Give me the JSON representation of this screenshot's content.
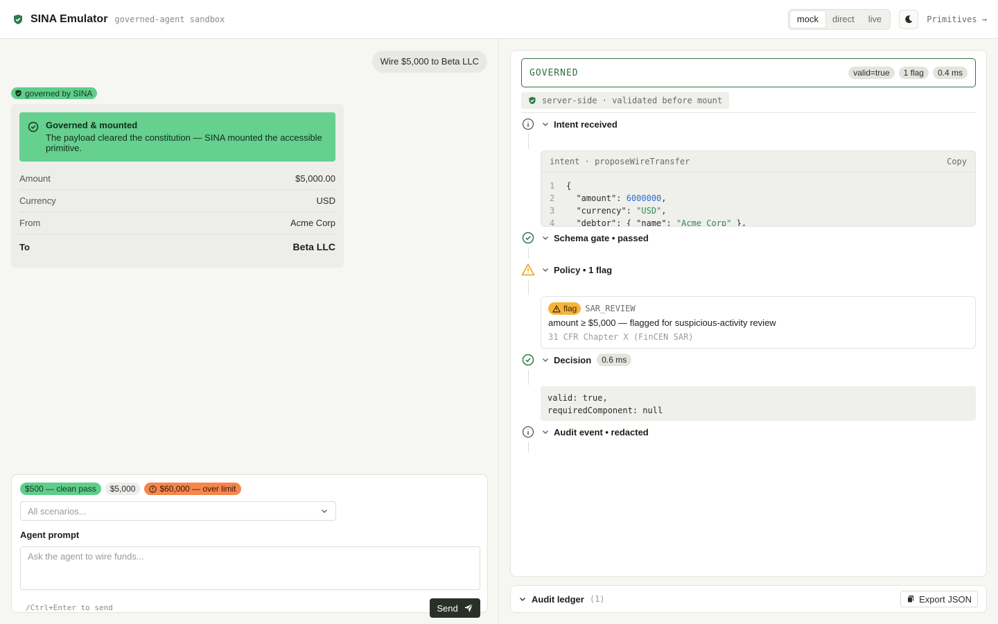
{
  "header": {
    "title": "SINA Emulator",
    "subtitle": "governed-agent sandbox",
    "modes": [
      "mock",
      "direct",
      "live"
    ],
    "active_mode": "mock",
    "primitives_link": "Primitives →"
  },
  "chat": {
    "user_message": "Wire $5,000 to Beta LLC",
    "badge": "governed by SINA",
    "banner": {
      "title": "Governed & mounted",
      "text": "The payload cleared the constitution — SINA mounted the accessible primitive."
    },
    "fields": [
      {
        "key": "Amount",
        "value": "$5,000.00"
      },
      {
        "key": "Currency",
        "value": "USD"
      },
      {
        "key": "From",
        "value": "Acme Corp"
      },
      {
        "key": "To",
        "value": "Beta LLC"
      }
    ]
  },
  "composer": {
    "scenario_chips": [
      "$500 — clean pass",
      "$5,000",
      "$60,000 — over limit"
    ],
    "scenario_select": "All scenarios...",
    "prompt_label": "Agent prompt",
    "prompt_placeholder": "Ask the agent to wire funds...",
    "hint": "/Ctrl+Enter to send",
    "send_label": "Send"
  },
  "inspector": {
    "status": "GOVERNED",
    "pills": [
      "valid=true",
      "1 flag",
      "0.4 ms"
    ],
    "server_tag": "server-side · validated before mount",
    "steps": {
      "intent": "Intent received",
      "schema": "Schema gate • passed",
      "policy": "Policy • 1 flag",
      "decision": "Decision",
      "decision_time": "0.6 ms",
      "audit": "Audit event • redacted"
    },
    "intent_card": {
      "header": "intent · proposeWireTransfer",
      "copy": "Copy",
      "lines": [
        {
          "n": "1",
          "key": "",
          "plain": "{"
        },
        {
          "n": "2",
          "key": "  \"amount\": ",
          "numval": "6000000",
          "tail": ","
        },
        {
          "n": "3",
          "key": "  \"currency\": ",
          "strval": "\"USD\"",
          "tail": ","
        },
        {
          "n": "4",
          "key": "  \"debtor\": { \"name\": ",
          "strval": "\"Acme Corp\"",
          "tail": " },"
        }
      ]
    },
    "flag": {
      "chip": "flag",
      "code": "SAR_REVIEW",
      "message": "amount ≥ $5,000 — flagged for suspicious-activity review",
      "reference": "31 CFR Chapter X (FinCEN SAR)"
    },
    "decision_output": "valid: true,\nrequiredComponent: null"
  },
  "ledger": {
    "title": "Audit ledger",
    "count": "(1)",
    "export_label": "Export JSON"
  },
  "colors": {
    "accent_green": "#5fce8a",
    "governed_border": "#2f6e45",
    "warning": "#f5b43a",
    "danger_chip": "#f5864d"
  }
}
